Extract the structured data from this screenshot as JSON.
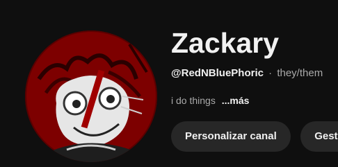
{
  "channel": {
    "name": "Zackary",
    "handle": "@RedNBluePhoric",
    "separator": "·",
    "pronouns": "they/them",
    "description": "i do things",
    "more_label": "...más",
    "avatar_icon": "channel-avatar-icon"
  },
  "actions": {
    "customize_label": "Personalizar canal",
    "manage_label": "Gestionar videos"
  },
  "colors": {
    "background": "#0f0f0f",
    "button_bg": "#272727",
    "avatar_red": "#8b0000"
  }
}
